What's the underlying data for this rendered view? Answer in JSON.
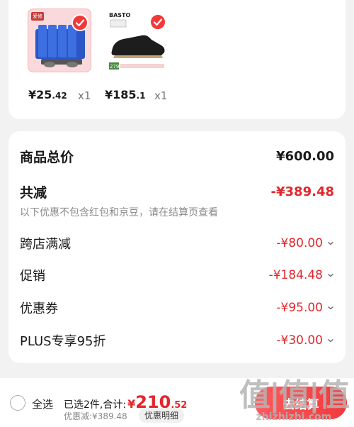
{
  "products": [
    {
      "tag": "爱修",
      "price_yen": "¥",
      "price_int": "25",
      "price_dec": ".42",
      "qty": "x1"
    },
    {
      "brand": "BASTO",
      "badge": "279",
      "price_yen": "¥",
      "price_int": "185",
      "price_dec": ".1",
      "qty": "x1"
    }
  ],
  "summary": {
    "total_label": "商品总价",
    "total_value": "¥600.00",
    "reduced_label": "共减",
    "reduced_value": "-¥389.48",
    "note": "以下优惠不包含红包和京豆，请在结算页查看",
    "items": [
      {
        "label": "跨店满减",
        "value": "-¥80.00"
      },
      {
        "label": "促销",
        "value": "-¥184.48"
      },
      {
        "label": "优惠券",
        "value": "-¥95.00"
      },
      {
        "label": "PLUS专享95折",
        "value": "-¥30.00"
      }
    ]
  },
  "bottom": {
    "select_all": "全选",
    "selected_text": "已选2件,合计:",
    "total_yen": "¥",
    "total_int": "210",
    "total_dec": ".52",
    "discount_text": "优惠减:¥389.48",
    "detail_button": "优惠明细",
    "checkout_button": "去结算",
    "watermark_big": "值|值|值",
    "watermark_small": "zhizhizhi.com"
  },
  "colors": {
    "accent": "#e3262b",
    "checkout": "#f2393a"
  }
}
